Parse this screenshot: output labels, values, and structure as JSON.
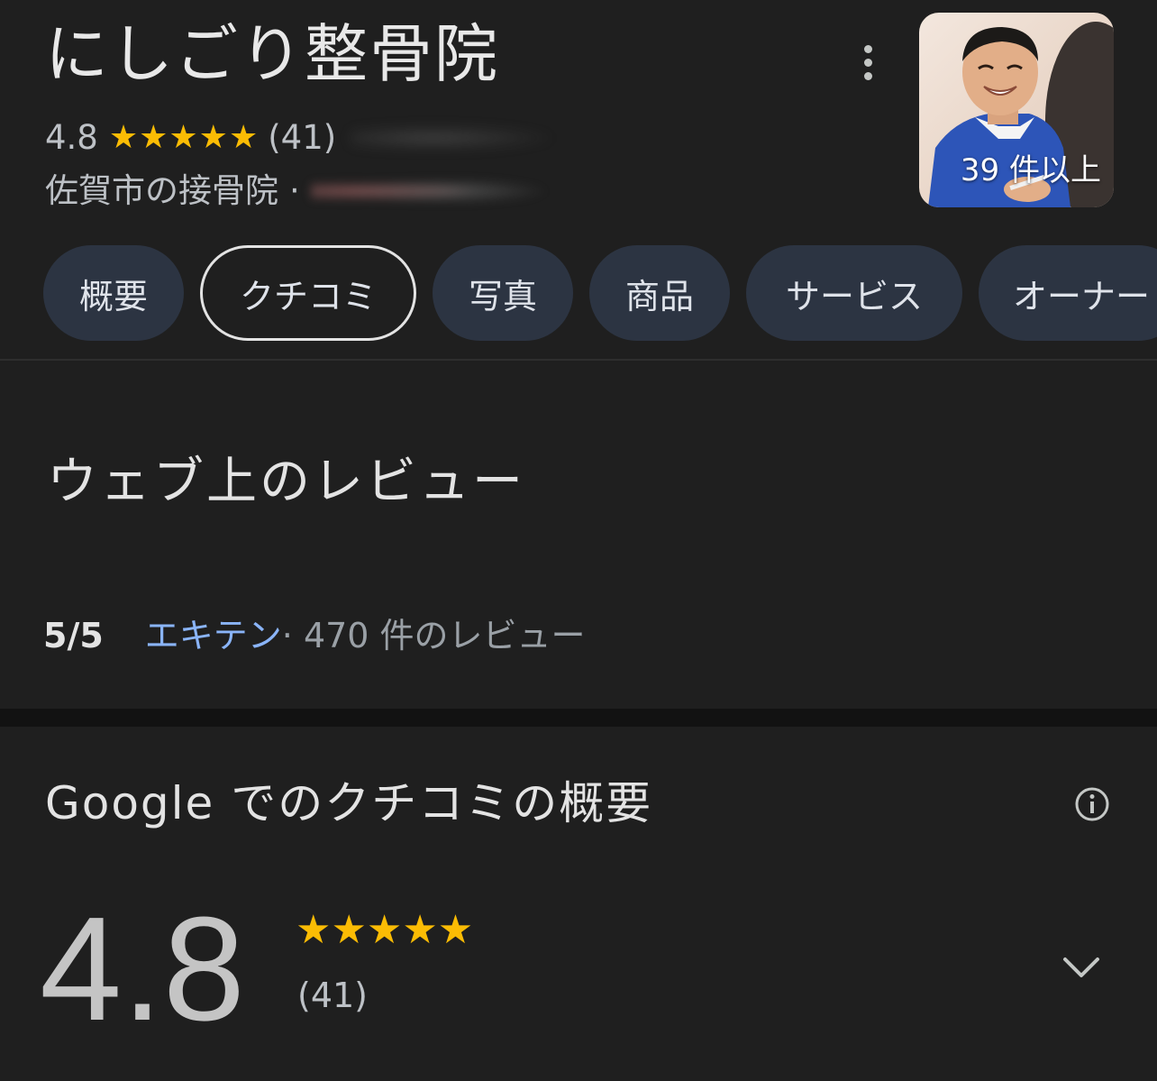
{
  "header": {
    "title": "にしごり整骨院",
    "rating": "4.8",
    "stars": "★★★★★",
    "review_count": "(41)",
    "category": "佐賀市の接骨院",
    "separator": "·",
    "more_icon": "more-vert-icon"
  },
  "photo": {
    "count_label": "39 件以上"
  },
  "tabs": [
    {
      "label": "概要",
      "selected": false
    },
    {
      "label": "クチコミ",
      "selected": true
    },
    {
      "label": "写真",
      "selected": false
    },
    {
      "label": "商品",
      "selected": false
    },
    {
      "label": "サービス",
      "selected": false
    },
    {
      "label": "オーナー",
      "selected": false
    }
  ],
  "web_reviews": {
    "heading": "ウェブ上のレビュー",
    "score": "5/5",
    "source": "エキテン",
    "meta": " · 470 件のレビュー"
  },
  "google_reviews": {
    "heading": "Google でのクチコミの概要",
    "rating": "4.8",
    "stars": "★★★★★",
    "count": "(41)",
    "info_icon": "info-icon",
    "expand_icon": "chevron-down-icon"
  },
  "colors": {
    "background": "#1f1f1f",
    "star": "#fbbc04",
    "link": "#8ab4f8",
    "chip": "#2c3442"
  }
}
